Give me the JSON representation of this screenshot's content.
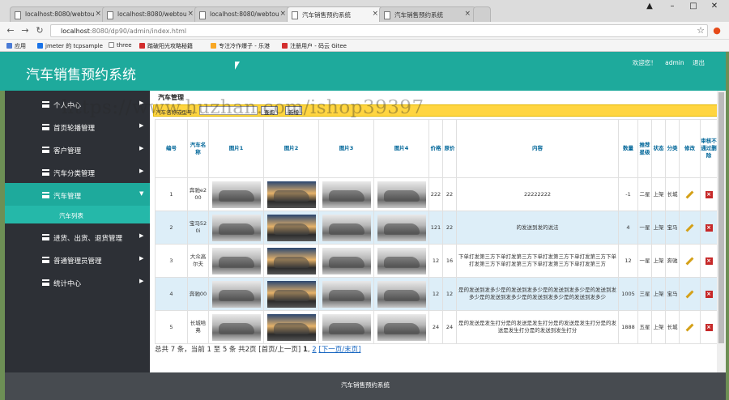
{
  "browser": {
    "tabs": [
      {
        "label": "localhost:8080/webtou"
      },
      {
        "label": "localhost:8080/webtou"
      },
      {
        "label": "localhost:8080/webtou"
      },
      {
        "label": "汽车销售预约系统"
      },
      {
        "label": "汽车销售预约系统"
      }
    ],
    "url_host": "localhost",
    "url_path": ":8080/dp90/admin/index.html",
    "bookmarks": [
      {
        "label": "应用",
        "color": "#4a7bd6"
      },
      {
        "label": "jmeter 的 tcpsample",
        "color": "#1a73e8"
      },
      {
        "label": "three",
        "color": "#888888"
      },
      {
        "label": "踏破阳光攻略秘籍",
        "color": "#d32f2f"
      },
      {
        "label": "专注冷作爆子 - 乐港",
        "color": "#f9a825"
      },
      {
        "label": "注册用户 - 码云 Gitee",
        "color": "#d32f2f"
      }
    ]
  },
  "app": {
    "title": "汽车销售预约系统",
    "welcome": "欢迎您！",
    "user": "admin",
    "logout": "退出",
    "footer": "汽车销售预约系统"
  },
  "sidebar": {
    "items": [
      {
        "label": "个人中心"
      },
      {
        "label": "首页轮播管理"
      },
      {
        "label": "客户管理"
      },
      {
        "label": "汽车分类管理"
      },
      {
        "label": "汽车管理"
      },
      {
        "label": "进货、出货、退货管理"
      },
      {
        "label": "普通管理员管理"
      },
      {
        "label": "统计中心"
      }
    ],
    "sub_label": "汽车列表"
  },
  "main": {
    "breadcrumb": "汽车管理",
    "search_label": "汽车名称或型号:",
    "search_value": "",
    "search_button": "查询",
    "add_button": "新增",
    "headers": [
      "编号",
      "汽车名称",
      "图片1",
      "图片2",
      "图片3",
      "图片4",
      "价格",
      "原价",
      "内容",
      "数量",
      "推荐星级",
      "状态",
      "分类",
      "修改",
      "审核不通过删除"
    ],
    "rows": [
      {
        "id": "1",
        "name": "奔驰e200",
        "price": "222",
        "orig": "22",
        "content": "22222222",
        "qty": "-1",
        "star": "二星",
        "status": "上架",
        "cat": "长城"
      },
      {
        "id": "2",
        "name": "宝马520i",
        "price": "121",
        "orig": "22",
        "content": "的发送到发的说法",
        "qty": "4",
        "star": "一星",
        "status": "上架",
        "cat": "宝马"
      },
      {
        "id": "3",
        "name": "大众高尔夫",
        "price": "12",
        "orig": "16",
        "content": "下单打发第三方下单打发第三方下单打发第三方下单打发第三方下单打发第三方下单打发第三方下单打发第三方下单打发第三方",
        "qty": "12",
        "star": "一星",
        "status": "上架",
        "cat": "奔驰"
      },
      {
        "id": "4",
        "name": "奔驰00",
        "price": "12",
        "orig": "12",
        "content": "是的发送到发多少是的发送到发多少是的发送到发多少是的发送到发多少是的发送到发多少是的发送到发多少是的发送到发多少",
        "qty": "1005",
        "star": "三星",
        "status": "上架",
        "cat": "宝马"
      },
      {
        "id": "5",
        "name": "长城哈弗",
        "price": "24",
        "orig": "24",
        "content": "是的发送是发生打分是的发送是发生打分是的发送是发生打分是的发送是发生打分是的发送到发生打分",
        "qty": "1888",
        "star": "五星",
        "status": "上架",
        "cat": "长城"
      }
    ],
    "pager": {
      "summary": "总共 7 条，当前 1 至 5 条 共2页",
      "first_prev": "[首页/上一页]",
      "p1": "1",
      "p2": "2",
      "next_last": "[下一页/末页]"
    }
  },
  "watermark": "https://www.huzhan.com/ishop39397"
}
